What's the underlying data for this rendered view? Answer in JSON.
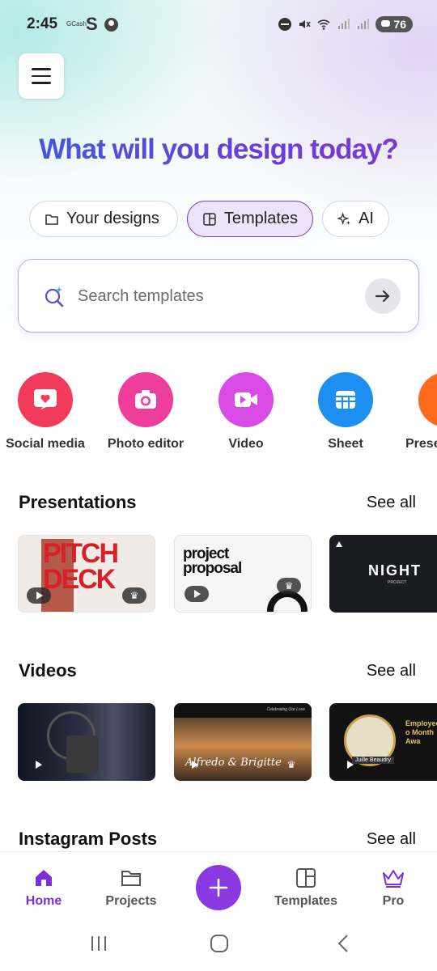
{
  "status_bar": {
    "time": "2:45",
    "carrier_tag": "GCash",
    "s_icon": "S",
    "battery": "76"
  },
  "headline": "What will you design today?",
  "chips": [
    {
      "label": "Your designs",
      "icon": "folder-icon"
    },
    {
      "label": "Templates",
      "icon": "templates-icon"
    },
    {
      "label": "AI",
      "icon": "sparkle-icon"
    }
  ],
  "search": {
    "placeholder": "Search templates"
  },
  "shortcuts": [
    {
      "label": "Social media",
      "color": "#f03b5a",
      "icon": "heart-icon"
    },
    {
      "label": "Photo editor",
      "color": "#ee3d9a",
      "icon": "camera-icon"
    },
    {
      "label": "Video",
      "color": "#d94be5",
      "icon": "video-icon"
    },
    {
      "label": "Sheet",
      "color": "#1d8ff0",
      "icon": "sheet-icon"
    },
    {
      "label": "Prese",
      "color": "#ff6a1a",
      "icon": "presentation-icon"
    }
  ],
  "sections": {
    "presentations": {
      "title": "Presentations",
      "see_all": "See all",
      "cards": [
        {
          "line1": "PITCH",
          "line2": "DECK"
        },
        {
          "line1": "project",
          "line2": "proposal"
        },
        {
          "line1": "NIGHT",
          "line2": "PROJECT"
        }
      ]
    },
    "videos": {
      "title": "Videos",
      "see_all": "See all",
      "cards": [
        {
          "caption": ""
        },
        {
          "caption": "Celebrating Our Love",
          "names": "Alfredo & Brigitte"
        },
        {
          "title": "Employee o Month Awa",
          "name": "Juille Beaudry"
        }
      ]
    },
    "instagram": {
      "title": "Instagram Posts",
      "see_all": "See all"
    }
  },
  "bottom_nav": [
    {
      "label": "Home",
      "active": true
    },
    {
      "label": "Projects",
      "active": false
    },
    {
      "label": "Templates",
      "active": false
    },
    {
      "label": "Pro",
      "active": false
    }
  ],
  "colors": {
    "accent": "#8a3ae0",
    "headline_from": "#3f5bd8",
    "headline_to": "#7d3ad0"
  }
}
